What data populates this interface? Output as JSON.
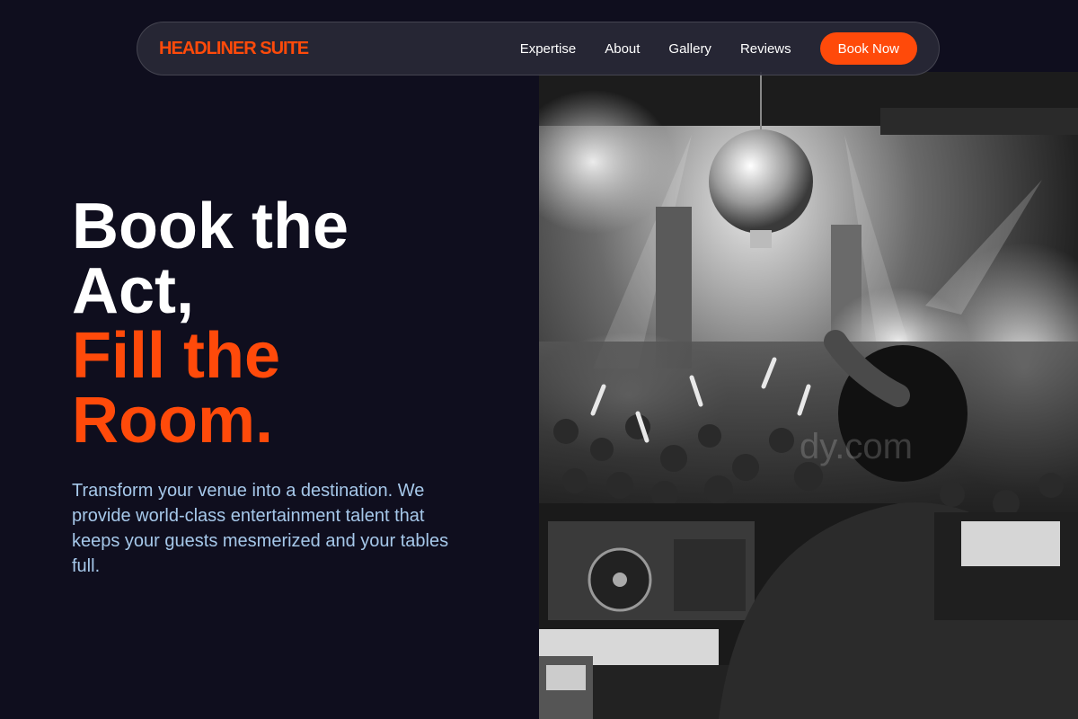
{
  "brand": {
    "name": "HEADLINER SUITE",
    "color": "#ff4a0a"
  },
  "nav": {
    "links": [
      "Expertise",
      "About",
      "Gallery",
      "Reviews"
    ],
    "cta_label": "Book Now"
  },
  "hero": {
    "headline_white": [
      "Book the",
      "Act,"
    ],
    "headline_accent": [
      "Fill the",
      "Room."
    ],
    "subtext": "Transform your venue into a destination. We provide world-class entertainment talent that keeps your guests mesmerized and your tables full.",
    "image_description_icon": "dj-crowd-photo"
  },
  "colors": {
    "background": "#0f0e1e",
    "accent": "#ff4a0a",
    "subtext": "#a6c8ea"
  }
}
